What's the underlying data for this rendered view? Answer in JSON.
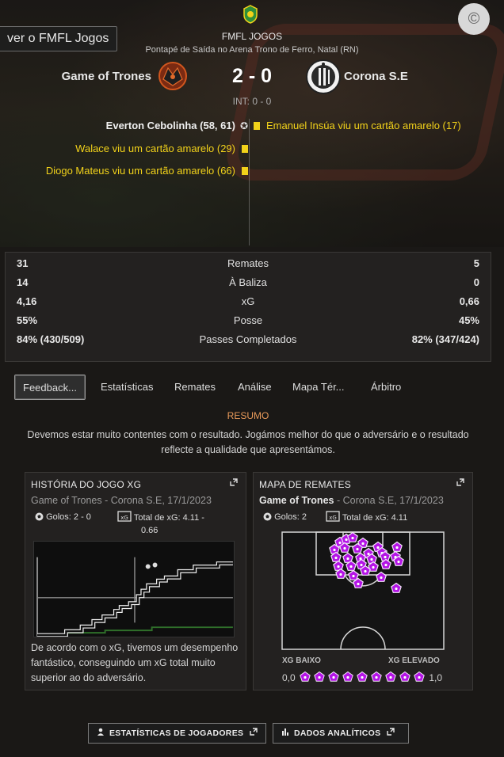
{
  "nav": {
    "back_label": "ver o FMFL Jogos",
    "corner_glyph": "©"
  },
  "match": {
    "competition": "FMFL JOGOS",
    "venue": "Pontapé de Saída no Arena Trono de Ferro, Natal (RN)",
    "home_team": "Game of Trones",
    "away_team": "Corona S.E",
    "score": "2 - 0",
    "halftime": "INT: 0 - 0",
    "colors": {
      "yellow_card": "#f2d21a",
      "accent": "#e89a5a",
      "shot_marker": "#b414e6"
    }
  },
  "events": {
    "home": [
      "Everton Cebolinha (58, 61)",
      "Walace viu um cartão amarelo (29)",
      "Diogo Mateus viu um cartão amarelo (66)"
    ],
    "away": [
      "Emanuel Insúa viu um cartão amarelo (17)"
    ]
  },
  "stats": [
    {
      "home": "31",
      "label": "Remates",
      "away": "5"
    },
    {
      "home": "14",
      "label": "À Baliza",
      "away": "0"
    },
    {
      "home": "4,16",
      "label": "xG",
      "away": "0,66"
    },
    {
      "home": "55%",
      "label": "Posse",
      "away": "45%"
    },
    {
      "home": "84% (430/509)",
      "label": "Passes Completados",
      "away": "82% (347/424)"
    }
  ],
  "tabs": [
    "Feedback...",
    "Estatísticas",
    "Remates",
    "Análise",
    "Mapa Tér...",
    "Árbitro"
  ],
  "summary": {
    "title": "RESUMO",
    "text": "Devemos estar muito contentes com o resultado. Jogámos melhor do que o adversário e o resultado reflecte a qualidade que apresentámos."
  },
  "xg_widget": {
    "title": "HISTÓRIA DO JOGO XG",
    "team": "Game of Trones",
    "subtitle_rest": " - Corona S.E, 17/1/2023",
    "goals": "Golos: 2 - 0",
    "total_xg_line1": "Total de xG: 4.11 -",
    "total_xg_line2": "0.66",
    "description": "De acordo com o xG, tivemos um desempenho fantástico, conseguindo um xG total muito superior ao do adversário."
  },
  "shots_widget": {
    "title": "MAPA DE REMATES",
    "team": "Game of Trones",
    "subtitle_rest": " - Corona S.E, 17/1/2023",
    "goals": "Golos: 2",
    "total_xg": "Total de xG: 4.11",
    "legend_low": "XG BAIXO",
    "legend_high": "XG ELEVADO",
    "scale_min": "0,0",
    "scale_max": "1,0"
  },
  "footer": {
    "player_stats": "ESTATÍSTICAS DE JOGADORES",
    "analytics": "DADOS ANALÍTICOS"
  },
  "icons": {
    "goal_event": "gear-ball-icon",
    "card": "yellow-card-icon",
    "expand": "expand-icon",
    "ball": "football-icon",
    "xg": "xg-icon",
    "person": "person-icon",
    "bars": "bar-chart-icon",
    "external": "external-link-icon"
  }
}
